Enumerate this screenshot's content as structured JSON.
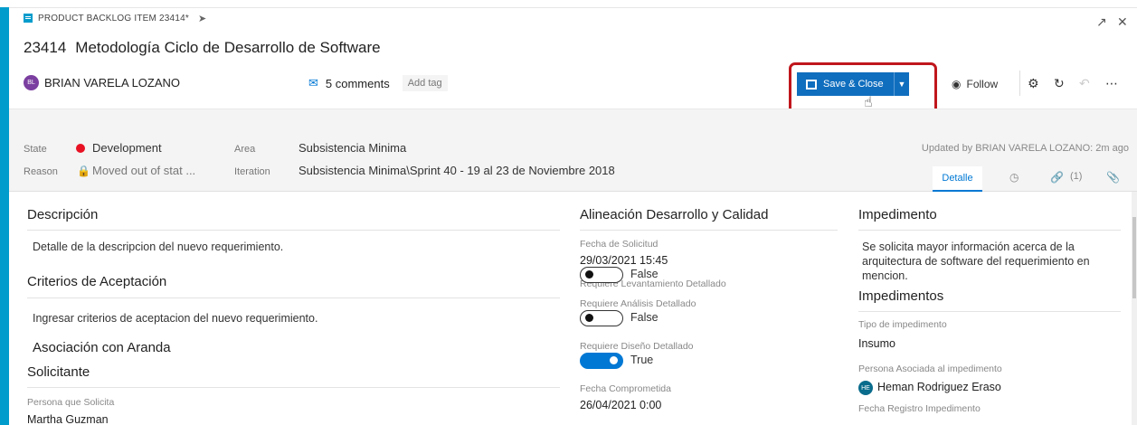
{
  "header": {
    "item_type": "PRODUCT BACKLOG ITEM 23414*",
    "work_item_id": "23414",
    "title": "Metodología Ciclo de Desarrollo de Software",
    "assigned_to": "BRIAN VARELA LOZANO",
    "assigned_initials": "BL",
    "comments": "5 comments",
    "add_tag": "Add tag"
  },
  "toolbar": {
    "save_close": "Save & Close",
    "follow": "Follow"
  },
  "meta": {
    "state_label": "State",
    "state_value": "Development",
    "reason_label": "Reason",
    "reason_value": "Moved out of stat ...",
    "area_label": "Area",
    "area_value": "Subsistencia Minima",
    "iteration_label": "Iteration",
    "iteration_value": "Subsistencia Minima\\Sprint 40 - 19 al 23 de Noviembre 2018",
    "updated_by": "Updated by BRIAN VARELA LOZANO: 2m ago"
  },
  "tabs": {
    "detalle": "Detalle",
    "links_count": "(1)"
  },
  "left_column": {
    "descripcion_heading": "Descripción",
    "descripcion_text": "Detalle de la descripcion del nuevo requerimiento.",
    "criterios_heading": "Criterios de Aceptación",
    "criterios_text": "Ingresar criterios de aceptacion del nuevo requerimiento.",
    "asociacion_heading": "Asociación con Aranda",
    "solicitante_heading": "Solicitante",
    "persona_label": "Persona que Solicita",
    "persona_value": "Martha Guzman"
  },
  "middle_column": {
    "heading": "Alineación Desarrollo y Calidad",
    "fecha_solicitud_label": "Fecha de Solicitud",
    "fecha_solicitud_value": "29/03/2021 15:45",
    "levantamiento_label": "Requiere Levantamiento Detallado",
    "levantamiento_value": "False",
    "analisis_label": "Requiere Análisis Detallado",
    "analisis_value": "False",
    "diseno_label": "Requiere Diseño Detallado",
    "diseno_value": "True",
    "fecha_comprometida_label": "Fecha Comprometida",
    "fecha_comprometida_value": "26/04/2021 0:00"
  },
  "right_column": {
    "impedimento_heading": "Impedimento",
    "impedimento_text": "Se solicita mayor información acerca de la arquitectura de software del requerimiento en mencion.",
    "impedimentos_heading": "Impedimentos",
    "tipo_label": "Tipo de impedimento",
    "tipo_value": "Insumo",
    "persona_label": "Persona Asociada al impedimento",
    "persona_value": "Heman Rodriguez Eraso",
    "persona_initials": "HE",
    "fecha_registro_label": "Fecha Registro Impedimento"
  },
  "colors": {
    "accent": "#009ccc",
    "primary_button": "#106ebe",
    "state_dot": "#e81123",
    "highlight": "#c0161d"
  }
}
